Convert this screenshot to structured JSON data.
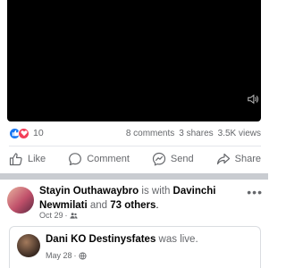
{
  "video": {
    "volume_icon": "speaker-icon"
  },
  "stats": {
    "reaction_count": "10",
    "comments": "8 comments",
    "shares": "3 shares",
    "views": "3.5K views"
  },
  "actions": {
    "like": "Like",
    "comment": "Comment",
    "send": "Send",
    "share": "Share"
  },
  "post": {
    "author": "Stayin Outhawaybro",
    "with_text": " is with ",
    "tagged": "Davinchi Newmilati",
    "and_text": " and ",
    "others": "73 others",
    "period": ".",
    "date": "Oct 29",
    "more": "•••"
  },
  "shared_post": {
    "author": "Dani KO Destinysfates",
    "status": " was live.",
    "date": "May 28"
  },
  "colors": {
    "accent": "#1877f2",
    "love": "#f33e58",
    "muted": "#65676b"
  }
}
